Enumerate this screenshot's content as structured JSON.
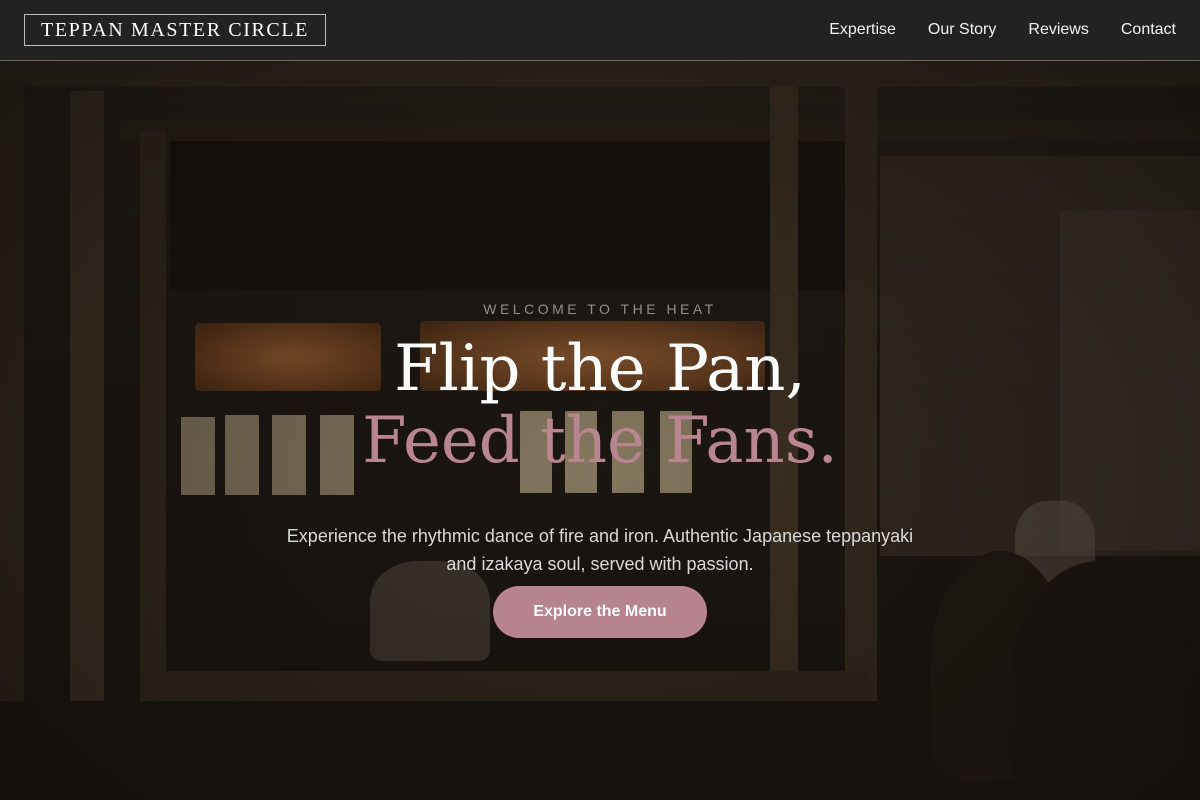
{
  "header": {
    "brand": "TEPPAN MASTER CIRCLE",
    "nav": [
      "Expertise",
      "Our Story",
      "Reviews",
      "Contact"
    ]
  },
  "hero": {
    "eyebrow": "WELCOME TO THE HEAT",
    "headline_line1": "Flip the Pan,",
    "headline_line2": "Feed the Fans.",
    "subtext": "Experience the rhythmic dance of fire and iron. Authentic Japanese teppanyaki and izakaya soul, served with passion.",
    "cta_label": "Explore the Menu"
  },
  "colors": {
    "header_bg": "#222222",
    "accent": "#b6838e",
    "headline_accent": "#b88590",
    "text_primary": "#ffffff"
  }
}
